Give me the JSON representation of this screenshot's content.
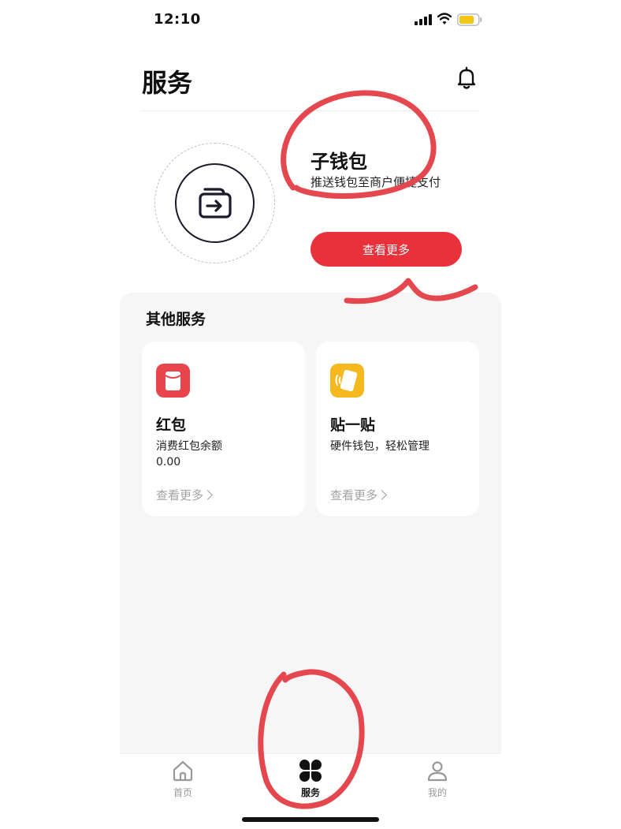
{
  "status_bar": {
    "time": "12:10"
  },
  "header": {
    "title": "服务",
    "icon": "bell-icon"
  },
  "wallet": {
    "title": "子钱包",
    "subtitle": "推送钱包至商户便捷支付",
    "button_label": "查看更多",
    "icon": "wallet-transfer-icon"
  },
  "other_services": {
    "title": "其他服务",
    "cards": [
      {
        "title": "红包",
        "desc": "消费红包余额",
        "value": "0.00",
        "more": "查看更多",
        "icon": "red-packet-icon",
        "color": "#e8454c"
      },
      {
        "title": "贴一贴",
        "desc": "硬件钱包，轻松管理",
        "more": "查看更多",
        "icon": "tap-card-icon",
        "color": "#f6b81f"
      }
    ]
  },
  "tab_bar": {
    "items": [
      {
        "label": "首页",
        "icon": "home-icon"
      },
      {
        "label": "服务",
        "icon": "clover-grid-icon",
        "active": true
      },
      {
        "label": "我的",
        "icon": "person-icon"
      }
    ]
  },
  "colors": {
    "accent": "#e8313a",
    "panel": "#f6f6f6",
    "annotation": "#e5474f"
  }
}
